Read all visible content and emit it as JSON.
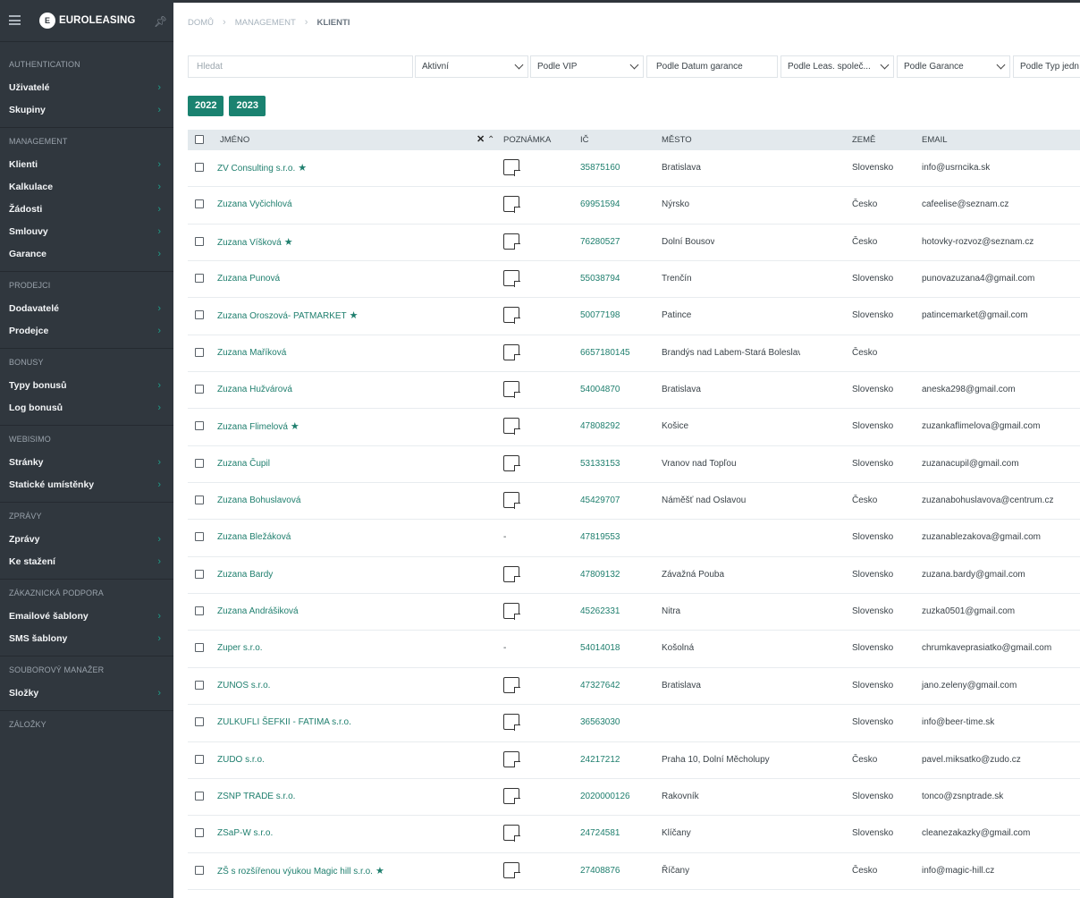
{
  "app": {
    "brand": "EUROLEASING",
    "accent": "#1a8270"
  },
  "sidebar": {
    "sections": [
      {
        "title": "AUTHENTICATION",
        "items": [
          "Uživatelé",
          "Skupiny"
        ]
      },
      {
        "title": "MANAGEMENT",
        "items": [
          "Klienti",
          "Kalkulace",
          "Žádosti",
          "Smlouvy",
          "Garance"
        ]
      },
      {
        "title": "PRODEJCI",
        "items": [
          "Dodavatelé",
          "Prodejce"
        ]
      },
      {
        "title": "BONUSY",
        "items": [
          "Typy bonusů",
          "Log bonusů"
        ]
      },
      {
        "title": "WEBISIMO",
        "items": [
          "Stránky",
          "Statické umístěnky"
        ]
      },
      {
        "title": "ZPRÁVY",
        "items": [
          "Zprávy",
          "Ke stažení"
        ]
      },
      {
        "title": "ZÁKAZNICKÁ PODPORA",
        "items": [
          "Emailové šablony",
          "SMS šablony"
        ]
      },
      {
        "title": "SOUBOROVÝ MANAŽER",
        "items": [
          "Složky"
        ]
      },
      {
        "title": "ZÁLOŽKY",
        "items": []
      }
    ]
  },
  "breadcrumb": {
    "home": "DOMŮ",
    "section": "MANAGEMENT",
    "current": "KLIENTI"
  },
  "filters": {
    "search_placeholder": "Hledat",
    "active": "Aktivní",
    "vip": "Podle VIP",
    "guarantee_date": "Podle Datum garance",
    "leasing_company": "Podle Leas. společ...",
    "guarantee": "Podle Garance",
    "type": "Podle Typ jedn"
  },
  "years": [
    "2022",
    "2023"
  ],
  "table": {
    "headers": {
      "name": "JMÉNO",
      "note": "POZNÁMKA",
      "ic": "IČ",
      "city": "MĚSTO",
      "country": "ZEMĚ",
      "email": "EMAIL"
    },
    "rows": [
      {
        "name": "ZV Consulting s.r.o.",
        "star": true,
        "note": true,
        "ic": "35875160",
        "city": "Bratislava",
        "country": "Slovensko",
        "email": "info@usrncika.sk"
      },
      {
        "name": "Zuzana Vyčichlová",
        "star": false,
        "note": true,
        "ic": "69951594",
        "city": "Nýrsko",
        "country": "Česko",
        "email": "cafeelise@seznam.cz"
      },
      {
        "name": "Zuzana Víšková",
        "star": true,
        "note": true,
        "ic": "76280527",
        "city": "Dolní Bousov",
        "country": "Česko",
        "email": "hotovky-rozvoz@seznam.cz"
      },
      {
        "name": "Zuzana Punová",
        "star": false,
        "note": true,
        "ic": "55038794",
        "city": "Trenčín",
        "country": "Slovensko",
        "email": "punovazuzana4@gmail.com"
      },
      {
        "name": "Zuzana Oroszová- PATMARKET",
        "star": true,
        "note": true,
        "ic": "50077198",
        "city": "Patince",
        "country": "Slovensko",
        "email": "patincemarket@gmail.com"
      },
      {
        "name": "Zuzana Maříková",
        "star": false,
        "note": true,
        "ic": "6657180145",
        "city": "Brandýs nad Labem-Stará Boleslav",
        "country": "Česko",
        "email": ""
      },
      {
        "name": "Zuzana Hužvárová",
        "star": false,
        "note": true,
        "ic": "54004870",
        "city": "Bratislava",
        "country": "Slovensko",
        "email": "aneska298@gmail.com"
      },
      {
        "name": "Zuzana Flimelová",
        "star": true,
        "note": true,
        "ic": "47808292",
        "city": "Košice",
        "country": "Slovensko",
        "email": "zuzankaflimelova@gmail.com"
      },
      {
        "name": "Zuzana Čupil",
        "star": false,
        "note": true,
        "ic": "53133153",
        "city": "Vranov nad Topľou",
        "country": "Slovensko",
        "email": "zuzanacupil@gmail.com"
      },
      {
        "name": "Zuzana Bohuslavová",
        "star": false,
        "note": true,
        "ic": "45429707",
        "city": "Náměšť nad Oslavou",
        "country": "Česko",
        "email": "zuzanabohuslavova@centrum.cz"
      },
      {
        "name": "Zuzana Bležáková",
        "star": false,
        "note": false,
        "note_text": "-",
        "ic": "47819553",
        "city": "",
        "country": "Slovensko",
        "email": "zuzanablezakova@gmail.com"
      },
      {
        "name": "Zuzana Bardy",
        "star": false,
        "note": true,
        "ic": "47809132",
        "city": "Závažná Pouba",
        "country": "Slovensko",
        "email": "zuzana.bardy@gmail.com"
      },
      {
        "name": "Zuzana Andrášiková",
        "star": false,
        "note": true,
        "ic": "45262331",
        "city": "Nitra",
        "country": "Slovensko",
        "email": "zuzka0501@gmail.com"
      },
      {
        "name": "Zuper s.r.o.",
        "star": false,
        "note": false,
        "note_text": "-",
        "ic": "54014018",
        "city": "Košolná",
        "country": "Slovensko",
        "email": "chrumkaveprasiatko@gmail.com"
      },
      {
        "name": "ZUNOS s.r.o.",
        "star": false,
        "note": true,
        "ic": "47327642",
        "city": "Bratislava",
        "country": "Slovensko",
        "email": "jano.zeleny@gmail.com"
      },
      {
        "name": "ZULKUFLI ŠEFKII - FATIMA s.r.o.",
        "star": false,
        "note": true,
        "ic": "36563030",
        "city": "",
        "country": "Slovensko",
        "email": "info@beer-time.sk"
      },
      {
        "name": "ZUDO s.r.o.",
        "star": false,
        "note": true,
        "ic": "24217212",
        "city": "Praha 10, Dolní Měcholupy",
        "country": "Česko",
        "email": "pavel.miksatko@zudo.cz"
      },
      {
        "name": "ZSNP TRADE s.r.o.",
        "star": false,
        "note": true,
        "ic": "2020000126",
        "city": "Rakovník",
        "country": "Slovensko",
        "email": "tonco@zsnptrade.sk"
      },
      {
        "name": "ZSaP-W s.r.o.",
        "star": false,
        "note": true,
        "ic": "24724581",
        "city": "Klíčany",
        "country": "Slovensko",
        "email": "cleanezakazky@gmail.com"
      },
      {
        "name": "ZŠ s rozšířenou výukou Magic hill s.r.o.",
        "star": true,
        "note": true,
        "ic": "27408876",
        "city": "Říčany",
        "country": "Česko",
        "email": "info@magic-hill.cz"
      }
    ]
  }
}
